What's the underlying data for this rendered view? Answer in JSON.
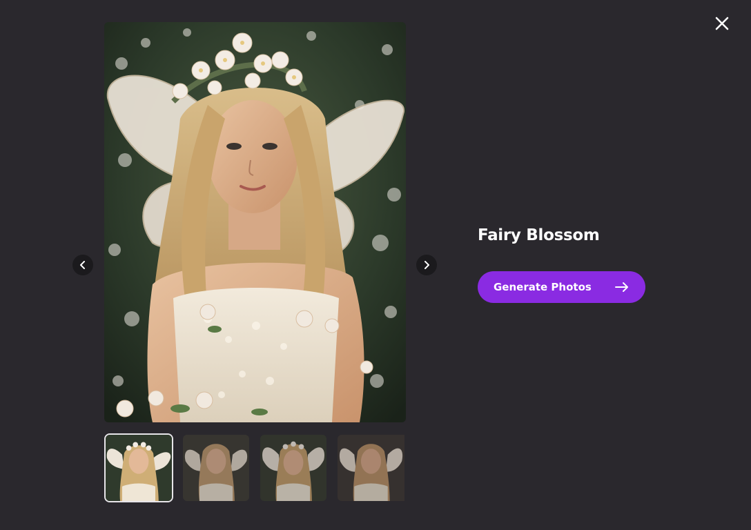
{
  "modal": {
    "title": "Fairy Blossom",
    "generate_button_label": "Generate Photos",
    "accent_color": "#8a2be2",
    "icons": {
      "close": "close-icon",
      "prev": "chevron-left-icon",
      "next": "chevron-right-icon",
      "arrow": "arrow-right-icon"
    },
    "thumbnails_count": 4,
    "selected_thumbnail": 1
  }
}
